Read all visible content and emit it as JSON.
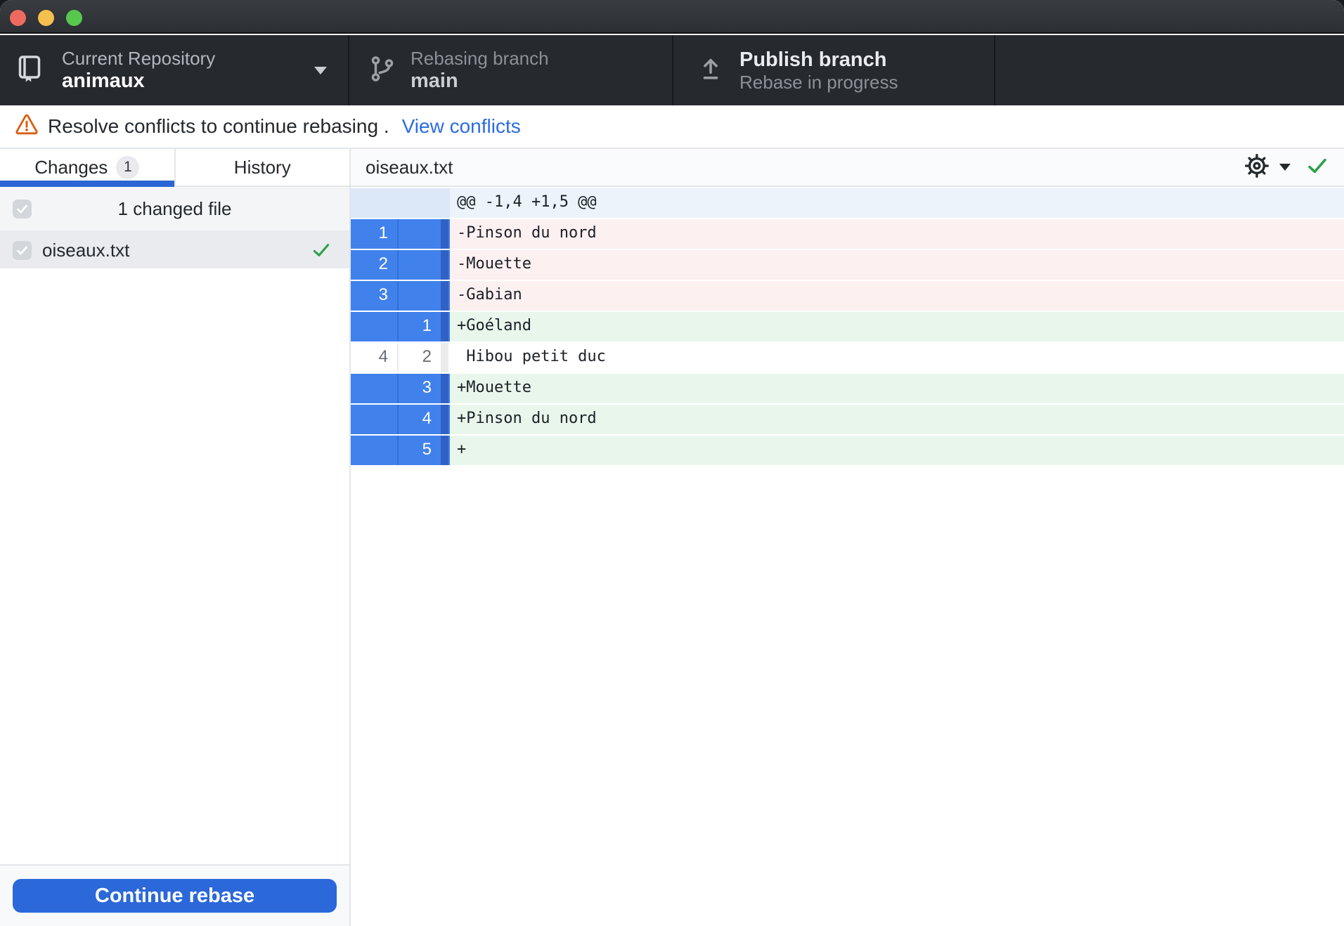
{
  "window": {
    "controls": [
      "close-button",
      "minimize-button",
      "zoom-button"
    ],
    "control_colors": {
      "close": "#ee6a5f",
      "minimize": "#f5c04d",
      "zoom": "#57c84d"
    }
  },
  "toolbar": {
    "repo": {
      "icon": "repo-icon",
      "label": "Current Repository",
      "title": "animaux"
    },
    "branch": {
      "icon": "git-branch-icon",
      "label": "Rebasing branch",
      "title": "main"
    },
    "publish": {
      "icon": "upload-icon",
      "title": "Publish branch",
      "subtitle": "Rebase in progress"
    }
  },
  "warning": {
    "icon": "alert-triangle-icon",
    "message": "Resolve conflicts to continue rebasing .",
    "link": "View conflicts"
  },
  "sidebar": {
    "tabs": [
      {
        "label": "Changes",
        "badge": "1",
        "selected": true
      },
      {
        "label": "History",
        "selected": false
      }
    ],
    "summary": "1 changed file",
    "files": [
      {
        "name": "oiseaux.txt",
        "checked": true,
        "status": "resolved-check-icon"
      }
    ],
    "continue_button": "Continue rebase"
  },
  "diff": {
    "file_name": "oiseaux.txt",
    "actions": [
      "gear-icon",
      "dropdown-caret-icon",
      "no-conflicts-check-icon"
    ],
    "rows": [
      {
        "type": "hunk",
        "old": "",
        "new": "",
        "text": "@@ -1,4 +1,5 @@"
      },
      {
        "type": "deleted",
        "old": "1",
        "new": "",
        "text": "-Pinson du nord"
      },
      {
        "type": "deleted",
        "old": "2",
        "new": "",
        "text": "-Mouette"
      },
      {
        "type": "deleted",
        "old": "3",
        "new": "",
        "text": "-Gabian"
      },
      {
        "type": "added",
        "old": "",
        "new": "1",
        "text": "+Goéland"
      },
      {
        "type": "context",
        "old": "4",
        "new": "2",
        "text": " Hibou petit duc"
      },
      {
        "type": "added",
        "old": "",
        "new": "3",
        "text": "+Mouette"
      },
      {
        "type": "added",
        "old": "",
        "new": "4",
        "text": "+Pinson du nord"
      },
      {
        "type": "added",
        "old": "",
        "new": "5",
        "text": "+"
      }
    ]
  },
  "colors": {
    "accent_blue": "#2b68d9",
    "link_blue": "#2a6be2",
    "gutter_blue": "#4181ec",
    "deleted_bg": "#fdf0f1",
    "added_bg": "#e9f6ec",
    "hunk_bg": "#edf3fb",
    "warning_orange": "#d95e10",
    "check_green": "#2ba14a",
    "toolbar_bg": "#26292e"
  }
}
